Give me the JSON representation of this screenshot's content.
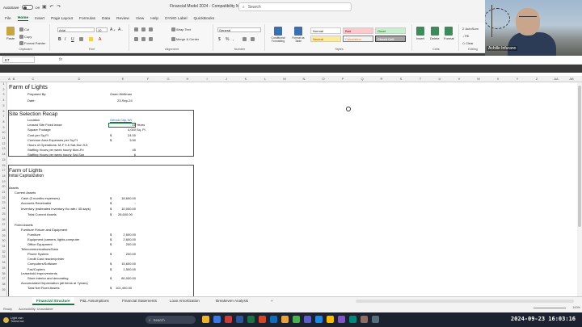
{
  "titlebar": {
    "autosave_label": "AutoSave",
    "autosave_state": "Off",
    "doc_title": "Financial Model 2024  -  Compatibility Mode",
    "search_placeholder": "Search"
  },
  "menu": [
    "File",
    "Home",
    "Insert",
    "Page Layout",
    "Formulas",
    "Data",
    "Review",
    "View",
    "Help",
    "DYMO Label",
    "QuickBooks"
  ],
  "menu_active": "Home",
  "ribbon": {
    "clipboard": {
      "paste": "Paste",
      "cut": "Cut",
      "copy": "Copy",
      "format_painter": "Format Painter",
      "label": "Clipboard"
    },
    "font": {
      "name": "Arial",
      "size": "10",
      "label": "Font"
    },
    "alignment": {
      "wrap": "Wrap Text",
      "merge": "Merge & Center",
      "label": "Alignment"
    },
    "number": {
      "format": "General",
      "label": "Number"
    },
    "styles": {
      "conditional": "Conditional Formatting",
      "format_table": "Format as Table",
      "normal": "Normal",
      "bad": "Bad",
      "good": "Good",
      "neutral": "Neutral",
      "calculation": "Calculation",
      "check_cell": "Check Cell",
      "label": "Styles"
    },
    "cells": {
      "insert": "Insert",
      "delete": "Delete",
      "format": "Format",
      "label": "Cells"
    },
    "editing": {
      "autosum": "AutoSum",
      "fill": "Fill",
      "clear": "Clear",
      "label": "Editing"
    }
  },
  "formula_bar": {
    "name_box": "E7",
    "fx": "fx"
  },
  "columns": [
    "A",
    "B",
    "C",
    "D",
    "E",
    "F",
    "G",
    "H",
    "I",
    "J",
    "K",
    "L",
    "M",
    "N",
    "O",
    "P",
    "Q",
    "R",
    "S",
    "T",
    "U",
    "V",
    "W",
    "X",
    "Y",
    "Z",
    "AA",
    "AB"
  ],
  "rows": [
    "1",
    "2",
    "3",
    "4",
    "5",
    "6",
    "7",
    "8",
    "9",
    "10",
    "11",
    "12",
    "13",
    "14",
    "15",
    "16",
    "17",
    "18",
    "19",
    "20",
    "21",
    "22",
    "23",
    "24",
    "25",
    "26",
    "27",
    "28",
    "29",
    "30",
    "31",
    "32",
    "33",
    "34",
    "35",
    "36",
    "37",
    "38",
    "39"
  ],
  "sheet": {
    "title": "Farm of Lights",
    "prepared_by_label": "Prepared By:",
    "prepared_by": "Gwen Wellman",
    "date_label": "Date:",
    "date": "23-Sep-24",
    "recap_title": "Site Selection Recap",
    "recap": [
      {
        "label": "Location",
        "dollar": "",
        "value": "Genoa City, WI",
        "unit": "",
        "link": true
      },
      {
        "label": "Leased Site Fixed lease",
        "dollar": "",
        "value": "10",
        "unit": "Years"
      },
      {
        "label": "Square Footage",
        "dollar": "",
        "value": "4,000",
        "unit": "Sq. Ft."
      },
      {
        "label": "Cost per Sq.Ft",
        "dollar": "$",
        "value": "24.00",
        "unit": ""
      },
      {
        "label": "Common Area Expenses per Sq.Ft",
        "dollar": "$",
        "value": "3.50",
        "unit": ""
      },
      {
        "label": "Hours of Operations: M-F 9-6 Sat-Sun 9-5",
        "dollar": "",
        "value": "",
        "unit": ""
      },
      {
        "label": "Staffing Hours per week hourly Mon-Fri",
        "dollar": "",
        "value": "45",
        "unit": ""
      },
      {
        "label": "Staffing Hours per week hourly Sat-Sun",
        "dollar": "",
        "value": "6",
        "unit": ""
      }
    ],
    "section2_title": "Farm of Lights",
    "section2_subtitle": "Initial Capitalization",
    "assets_label": "Assets",
    "current_assets_label": "Current Assets",
    "current_assets": [
      {
        "label": "Cash (3 months expenses)",
        "dollar": "$",
        "value": "18,600.00"
      },
      {
        "label": "Accounts Receivable",
        "dollar": "$",
        "value": "-"
      },
      {
        "label": "Inventory (estimated inventory t/o rate= 45 days)",
        "dollar": "$",
        "value": "10,000.00"
      }
    ],
    "total_current_label": "Total Current Assets",
    "total_current": "28,600.00",
    "fixed_assets_label": "Fixed Assets",
    "ffe_label": "Furniture Fixture and Equipment",
    "ffe": [
      {
        "label": "Furniture",
        "dollar": "$",
        "value": "2,500.00"
      },
      {
        "label": "Equipment (camera, lights,computer",
        "dollar": "$",
        "value": "2,600.00"
      },
      {
        "label": "Office Equipment",
        "dollar": "$",
        "value": "200.00"
      }
    ],
    "telecom_label": "Telecommunications/Data",
    "telecom": [
      {
        "label": "Phone System",
        "dollar": "$",
        "value": "200.00"
      },
      {
        "label": "Credit Card reader/printer",
        "dollar": "",
        "value": ""
      },
      {
        "label": "Computers/Software",
        "dollar": "$",
        "value": "15,600.00"
      },
      {
        "label": "Fax/Copiers",
        "dollar": "$",
        "value": "1,500.00"
      }
    ],
    "leasehold_label": "Leasehold improvements",
    "leasehold": [
      {
        "label": "Store interior and decorating",
        "dollar": "$",
        "value": "80,000.00"
      }
    ],
    "accum_label": "Accumulated Depreciation (all items at 7years)",
    "total_fixed_label": "Total Net Fixed Assets",
    "total_fixed": "101,400.00"
  },
  "tabs": [
    "Financial Structure",
    "P&L Assumptions",
    "Financial Statements",
    "Loan Amortization",
    "Breakeven Analysis"
  ],
  "tab_active": "Financial Structure",
  "add_tab": "+",
  "status": {
    "ready": "Ready",
    "accessibility": "Accessibility: Unavailable",
    "zoom": "100%"
  },
  "taskbar": {
    "weather_line1": "Light rain",
    "weather_line2": "Tomorrow",
    "search": "Search",
    "clock": "2024-09-23  16:03:16"
  },
  "webcam": {
    "name": "Achille Infurano"
  }
}
